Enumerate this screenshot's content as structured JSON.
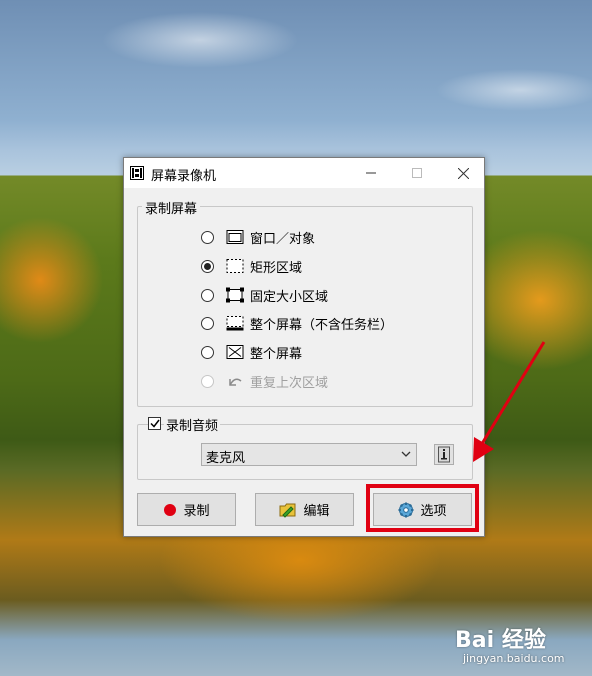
{
  "window": {
    "title": "屏幕录像机",
    "icon": "film-icon",
    "controls": {
      "minimize": "minimize-icon",
      "maximize": "maximize-icon",
      "close": "close-icon"
    }
  },
  "screen_group": {
    "legend": "录制屏幕",
    "options": [
      {
        "label": "窗口／对象",
        "icon": "window-icon",
        "checked": false,
        "enabled": true
      },
      {
        "label": "矩形区域",
        "icon": "dashed-rect-icon",
        "checked": true,
        "enabled": true
      },
      {
        "label": "固定大小区域",
        "icon": "fixed-rect-icon",
        "checked": false,
        "enabled": true
      },
      {
        "label": "整个屏幕（不含任务栏）",
        "icon": "screen-no-taskbar-icon",
        "checked": false,
        "enabled": true
      },
      {
        "label": "整个屏幕",
        "icon": "fullscreen-icon",
        "checked": false,
        "enabled": true
      },
      {
        "label": "重复上次区域",
        "icon": "undo-icon",
        "checked": false,
        "enabled": false
      }
    ]
  },
  "audio_group": {
    "legend": "录制音频",
    "checked": true,
    "device": "麦克风",
    "info_icon": "info-icon"
  },
  "buttons": {
    "record": "录制",
    "edit": "编辑",
    "options": "选项"
  },
  "colors": {
    "record_dot": "#e00012",
    "highlight": "#e00012"
  },
  "watermark": {
    "logo": "Bai  经验",
    "url": "jingyan.baidu.com"
  }
}
